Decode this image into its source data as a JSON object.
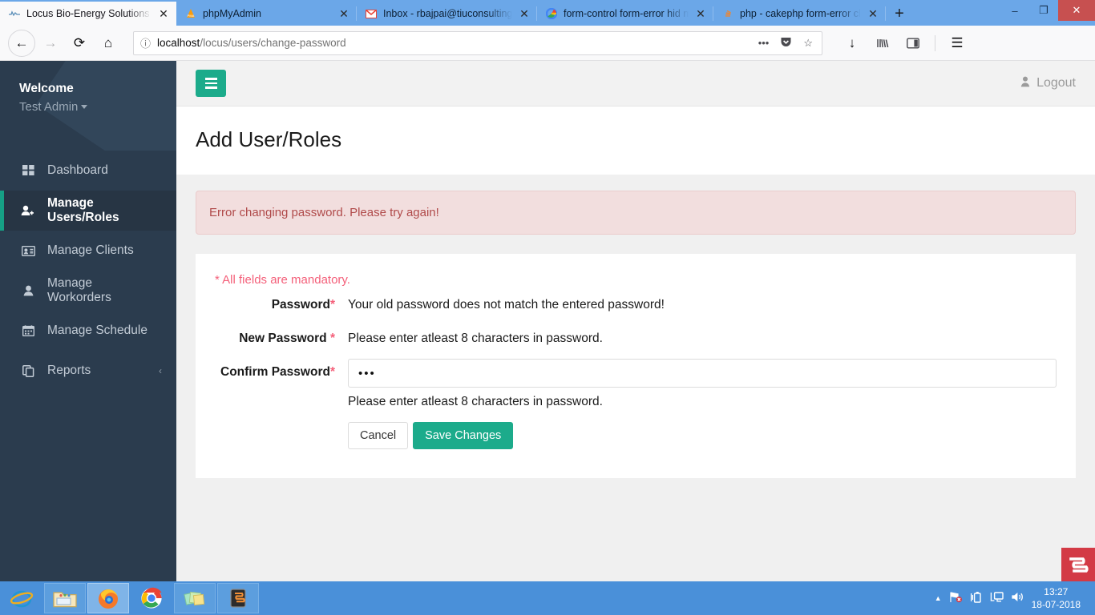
{
  "browser": {
    "tabs": [
      {
        "title": "Locus Bio-Energy Solutions",
        "favicon": "locus-logo-icon",
        "active": true
      },
      {
        "title": "phpMyAdmin",
        "favicon": "phpmyadmin-icon",
        "active": false
      },
      {
        "title": "Inbox - rbajpai@tiuconsulting.c",
        "favicon": "gmail-icon",
        "active": false
      },
      {
        "title": "form-control form-error hid my",
        "favicon": "google-icon",
        "active": false
      },
      {
        "title": "php - cakephp form-error class",
        "favicon": "stackoverflow-icon",
        "active": false
      }
    ],
    "new_tab_label": "+",
    "close_glyph": "✕",
    "window_controls": {
      "minimize": "–",
      "restore": "❐",
      "close": "✕"
    },
    "nav": {
      "back": "←",
      "forward": "→",
      "reload": "⟳",
      "home": "⌂",
      "url_host": "localhost",
      "url_path": "/locus/users/change-password",
      "info_icon": "ⓘ",
      "page_actions": "•••",
      "pocket_icon": "♥",
      "bookmark_icon": "☆",
      "download_icon": "↓",
      "library_icon": "|||\\",
      "sidebar_icon": "▤",
      "menu_icon": "☰"
    }
  },
  "sidebar": {
    "welcome": "Welcome",
    "user": "Test Admin",
    "items": [
      {
        "label": "Dashboard",
        "icon": "grid-icon",
        "active": false,
        "chevron": ""
      },
      {
        "label": "Manage Users/Roles",
        "icon": "user-plus-icon",
        "active": true,
        "chevron": ""
      },
      {
        "label": "Manage Clients",
        "icon": "id-card-icon",
        "active": false,
        "chevron": ""
      },
      {
        "label": "Manage Workorders",
        "icon": "user-icon",
        "active": false,
        "chevron": ""
      },
      {
        "label": "Manage Schedule",
        "icon": "calendar-icon",
        "active": false,
        "chevron": ""
      },
      {
        "label": "Reports",
        "icon": "copy-icon",
        "active": false,
        "chevron": "‹"
      }
    ]
  },
  "topbar": {
    "menu_toggle": "hamburger-icon",
    "logout_label": "Logout",
    "logout_icon": "user-icon"
  },
  "page": {
    "title": "Add User/Roles",
    "alert": "Error changing password. Please try again!",
    "mandatory_note": "* All fields are mandatory.",
    "fields": [
      {
        "label": "Password",
        "required_mark": "*",
        "label_space": false,
        "type": "message",
        "message": "Your old password does not match the entered password!"
      },
      {
        "label": "New Password",
        "required_mark": "*",
        "label_space": true,
        "type": "message",
        "message": "Please enter atleast 8 characters in password."
      },
      {
        "label": "Confirm Password",
        "required_mark": "*",
        "label_space": false,
        "type": "input",
        "value": "•••",
        "placeholder": "",
        "help": "Please enter atleast 8 characters in password."
      }
    ],
    "buttons": {
      "cancel": "Cancel",
      "save": "Save Changes"
    },
    "widget_glyph": "S"
  },
  "taskbar": {
    "items": [
      {
        "name": "internet-explorer-icon",
        "glyph": "🌐",
        "state": "plain"
      },
      {
        "name": "file-explorer-icon",
        "glyph": "🗂",
        "state": "open"
      },
      {
        "name": "firefox-icon",
        "glyph": "🦊",
        "state": "focus"
      },
      {
        "name": "chrome-icon",
        "glyph": "◉",
        "state": "plain"
      },
      {
        "name": "sticky-notes-icon",
        "glyph": "🗒",
        "state": "open"
      },
      {
        "name": "sublime-text-icon",
        "glyph": "S",
        "state": "open"
      }
    ],
    "tray": {
      "show_hidden": "▲",
      "network": "⚑",
      "battery": "▯",
      "monitor": "▣",
      "volume": "🔊",
      "time": "13:27",
      "date": "18-07-2018"
    }
  },
  "colors": {
    "accent_teal": "#1cab8b",
    "sidebar_bg": "#2b3c4e",
    "alert_bg": "#f2dede",
    "alert_text": "#b04a4a",
    "required_red": "#f4607a",
    "widget_red": "#d33a45",
    "taskbar_blue": "#4a90d9"
  }
}
